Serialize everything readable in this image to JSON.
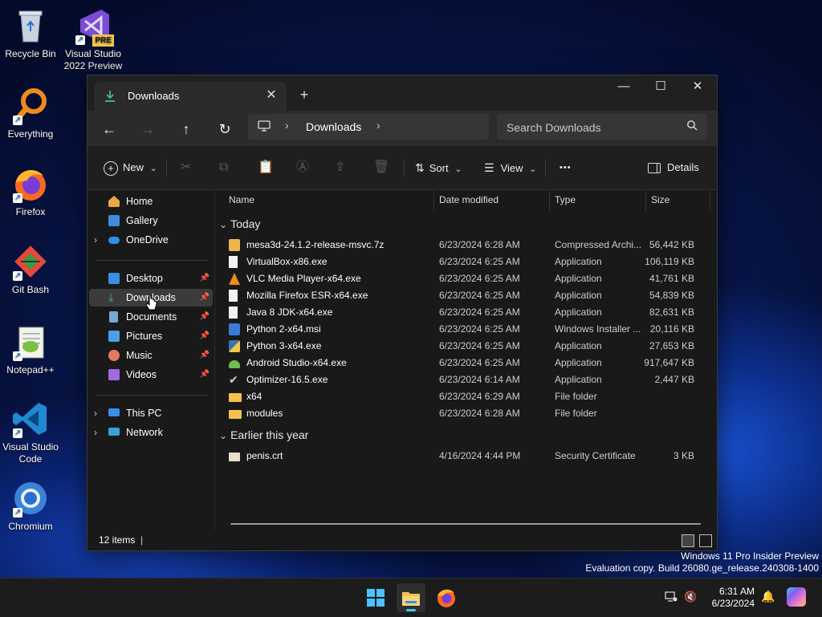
{
  "desktop": {
    "icons": [
      {
        "label": "Recycle Bin"
      },
      {
        "label": "Visual Studio 2022 Preview",
        "badge": "PRE"
      },
      {
        "label": "Everything"
      },
      {
        "label": "Firefox"
      },
      {
        "label": "Git Bash"
      },
      {
        "label": "Notepad++"
      },
      {
        "label": "Visual Studio Code"
      },
      {
        "label": "Chromium"
      }
    ]
  },
  "explorer": {
    "tab_title": "Downloads",
    "tab_close": "✕",
    "new_tab": "+",
    "window_controls": {
      "minimize": "—",
      "maximize": "☐",
      "close": "✕"
    },
    "nav": {
      "back": "←",
      "forward": "→",
      "up": "↑",
      "refresh": "↻"
    },
    "address": {
      "monitor_icon": "this-pc-icon",
      "sep": "›",
      "crumb": "Downloads"
    },
    "search": {
      "placeholder": "Search Downloads"
    },
    "toolbar": {
      "new_label": "New",
      "new_chev": "⌄",
      "sort_label": "Sort",
      "view_label": "View",
      "more_label": "•••",
      "details_label": "Details"
    },
    "sidebar": {
      "items": [
        {
          "label": "Home",
          "color": "#e9a93c"
        },
        {
          "label": "Gallery",
          "color": "#3d8be0"
        },
        {
          "label": "OneDrive",
          "color": "#2f8fe8"
        },
        {
          "label": "Desktop",
          "color": "#3a8ee6"
        },
        {
          "label": "Downloads",
          "color": "#3fbf7f"
        },
        {
          "label": "Documents",
          "color": "#7aa7d8"
        },
        {
          "label": "Pictures",
          "color": "#4aa0e8"
        },
        {
          "label": "Music",
          "color": "#e27a5e"
        },
        {
          "label": "Videos",
          "color": "#a06ce0"
        },
        {
          "label": "This PC",
          "color": "#3a8ee6"
        },
        {
          "label": "Network",
          "color": "#3aa0d8"
        }
      ],
      "chevron": "›",
      "pin": "📌"
    },
    "columns": {
      "name": "Name",
      "date": "Date modified",
      "type": "Type",
      "size": "Size"
    },
    "groups": [
      {
        "title": "Today",
        "rows": [
          {
            "name": "mesa3d-24.1.2-release-msvc.7z",
            "date": "6/23/2024 6:28 AM",
            "type": "Compressed Archi...",
            "size": "56,442 KB",
            "icon": "archive"
          },
          {
            "name": "VirtualBox-x86.exe",
            "date": "6/23/2024 6:25 AM",
            "type": "Application",
            "size": "106,119 KB",
            "icon": "doc"
          },
          {
            "name": "VLC Media Player-x64.exe",
            "date": "6/23/2024 6:25 AM",
            "type": "Application",
            "size": "41,761 KB",
            "icon": "vlc"
          },
          {
            "name": "Mozilla Firefox ESR-x64.exe",
            "date": "6/23/2024 6:25 AM",
            "type": "Application",
            "size": "54,839 KB",
            "icon": "doc"
          },
          {
            "name": "Java 8 JDK-x64.exe",
            "date": "6/23/2024 6:25 AM",
            "type": "Application",
            "size": "82,631 KB",
            "icon": "doc"
          },
          {
            "name": "Python 2-x64.msi",
            "date": "6/23/2024 6:25 AM",
            "type": "Windows Installer ...",
            "size": "20,116 KB",
            "icon": "msi"
          },
          {
            "name": "Python 3-x64.exe",
            "date": "6/23/2024 6:25 AM",
            "type": "Application",
            "size": "27,653 KB",
            "icon": "python"
          },
          {
            "name": "Android Studio-x64.exe",
            "date": "6/23/2024 6:25 AM",
            "type": "Application",
            "size": "917,647 KB",
            "icon": "android"
          },
          {
            "name": "Optimizer-16.5.exe",
            "date": "6/23/2024 6:14 AM",
            "type": "Application",
            "size": "2,447 KB",
            "icon": "check"
          },
          {
            "name": "x64",
            "date": "6/23/2024 6:29 AM",
            "type": "File folder",
            "size": "",
            "icon": "folder"
          },
          {
            "name": "modules",
            "date": "6/23/2024 6:28 AM",
            "type": "File folder",
            "size": "",
            "icon": "folder"
          }
        ]
      },
      {
        "title": "Earlier this year",
        "rows": [
          {
            "name": "penis.crt",
            "date": "4/16/2024 4:44 PM",
            "type": "Security Certificate",
            "size": "3 KB",
            "icon": "cert"
          }
        ]
      }
    ],
    "group_chevron": "⌄",
    "status": {
      "count": "12 items",
      "cursor": "|"
    }
  },
  "watermark": {
    "line1": "Windows 11 Pro Insider Preview",
    "line2": "Evaluation copy. Build 26080.ge_release.240308-1400"
  },
  "taskbar": {
    "time": "6:31 AM",
    "date": "6/23/2024",
    "accent": "#4cc2ff"
  }
}
